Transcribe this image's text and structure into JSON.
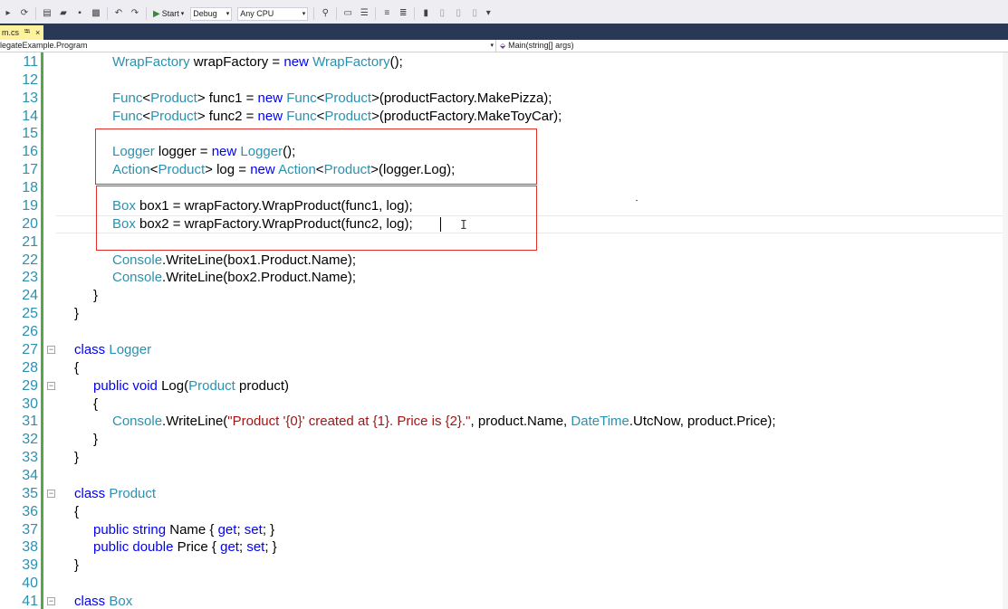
{
  "toolbar": {
    "start_label": "Start",
    "config": "Debug",
    "platform": "Any CPU"
  },
  "tab": {
    "label": "m.cs",
    "pin": "⭾",
    "close": "×"
  },
  "navbar": {
    "left": "legateExample.Program",
    "right": "Main(string[] args)"
  },
  "colors": {
    "keyword": "#0000ff",
    "type": "#2b91af",
    "string": "#a31515",
    "line_number": "#2b91af",
    "highlight_box": "#e0302c",
    "change_bar": "#57a64a"
  },
  "lines": [
    {
      "n": "11",
      "indent": 2,
      "tokens": [
        [
          "ty",
          "WrapFactory"
        ],
        [
          "p",
          " wrapFactory = "
        ],
        [
          "kw",
          "new"
        ],
        [
          "p",
          " "
        ],
        [
          "ty",
          "WrapFactory"
        ],
        [
          "p",
          "();"
        ]
      ]
    },
    {
      "n": "12",
      "indent": 0,
      "tokens": []
    },
    {
      "n": "13",
      "indent": 2,
      "tokens": [
        [
          "ty",
          "Func"
        ],
        [
          "p",
          "<"
        ],
        [
          "ty",
          "Product"
        ],
        [
          "p",
          "> func1 = "
        ],
        [
          "kw",
          "new"
        ],
        [
          "p",
          " "
        ],
        [
          "ty",
          "Func"
        ],
        [
          "p",
          "<"
        ],
        [
          "ty",
          "Product"
        ],
        [
          "p",
          ">(productFactory.MakePizza);"
        ]
      ]
    },
    {
      "n": "14",
      "indent": 2,
      "tokens": [
        [
          "ty",
          "Func"
        ],
        [
          "p",
          "<"
        ],
        [
          "ty",
          "Product"
        ],
        [
          "p",
          "> func2 = "
        ],
        [
          "kw",
          "new"
        ],
        [
          "p",
          " "
        ],
        [
          "ty",
          "Func"
        ],
        [
          "p",
          "<"
        ],
        [
          "ty",
          "Product"
        ],
        [
          "p",
          ">(productFactory.MakeToyCar);"
        ]
      ]
    },
    {
      "n": "15",
      "indent": 0,
      "tokens": []
    },
    {
      "n": "16",
      "indent": 2,
      "tokens": [
        [
          "ty",
          "Logger"
        ],
        [
          "p",
          " logger = "
        ],
        [
          "kw",
          "new"
        ],
        [
          "p",
          " "
        ],
        [
          "ty",
          "Logger"
        ],
        [
          "p",
          "();"
        ]
      ]
    },
    {
      "n": "17",
      "indent": 2,
      "tokens": [
        [
          "ty",
          "Action"
        ],
        [
          "p",
          "<"
        ],
        [
          "ty",
          "Product"
        ],
        [
          "p",
          "> log = "
        ],
        [
          "kw",
          "new"
        ],
        [
          "p",
          " "
        ],
        [
          "ty",
          "Action"
        ],
        [
          "p",
          "<"
        ],
        [
          "ty",
          "Product"
        ],
        [
          "p",
          ">(logger.Log);"
        ]
      ]
    },
    {
      "n": "18",
      "indent": 0,
      "tokens": []
    },
    {
      "n": "19",
      "indent": 2,
      "tokens": [
        [
          "ty",
          "Box"
        ],
        [
          "p",
          " box1 = wrapFactory.WrapProduct(func1, log);"
        ]
      ]
    },
    {
      "n": "20",
      "indent": 2,
      "tokens": [
        [
          "ty",
          "Box"
        ],
        [
          "p",
          " box2 = wrapFactory.WrapProduct(func2, log);"
        ]
      ]
    },
    {
      "n": "21",
      "indent": 0,
      "tokens": []
    },
    {
      "n": "22",
      "indent": 2,
      "tokens": [
        [
          "ty",
          "Console"
        ],
        [
          "p",
          ".WriteLine(box1.Product.Name);"
        ]
      ]
    },
    {
      "n": "23",
      "indent": 2,
      "tokens": [
        [
          "ty",
          "Console"
        ],
        [
          "p",
          ".WriteLine(box2.Product.Name);"
        ]
      ]
    },
    {
      "n": "24",
      "indent": 1,
      "tokens": [
        [
          "p",
          "}"
        ]
      ]
    },
    {
      "n": "25",
      "indent": 0,
      "tokens": [
        [
          "p",
          "}"
        ]
      ]
    },
    {
      "n": "26",
      "indent": 0,
      "tokens": []
    },
    {
      "n": "27",
      "indent": 0,
      "fold": true,
      "tokens": [
        [
          "kw",
          "class"
        ],
        [
          "p",
          " "
        ],
        [
          "ty",
          "Logger"
        ]
      ]
    },
    {
      "n": "28",
      "indent": 0,
      "tokens": [
        [
          "p",
          "{"
        ]
      ]
    },
    {
      "n": "29",
      "indent": 1,
      "fold": true,
      "tokens": [
        [
          "kw",
          "public"
        ],
        [
          "p",
          " "
        ],
        [
          "kw",
          "void"
        ],
        [
          "p",
          " Log("
        ],
        [
          "ty",
          "Product"
        ],
        [
          "p",
          " product)"
        ]
      ]
    },
    {
      "n": "30",
      "indent": 1,
      "tokens": [
        [
          "p",
          "{"
        ]
      ]
    },
    {
      "n": "31",
      "indent": 2,
      "tokens": [
        [
          "ty",
          "Console"
        ],
        [
          "p",
          ".WriteLine("
        ],
        [
          "str",
          "\"Product '{0}' created at {1}. Price is {2}.\""
        ],
        [
          "p",
          ", product.Name, "
        ],
        [
          "ty",
          "DateTime"
        ],
        [
          "p",
          ".UtcNow, product.Price);"
        ]
      ]
    },
    {
      "n": "32",
      "indent": 1,
      "tokens": [
        [
          "p",
          "}"
        ]
      ]
    },
    {
      "n": "33",
      "indent": 0,
      "tokens": [
        [
          "p",
          "}"
        ]
      ]
    },
    {
      "n": "34",
      "indent": 0,
      "tokens": []
    },
    {
      "n": "35",
      "indent": 0,
      "fold": true,
      "tokens": [
        [
          "kw",
          "class"
        ],
        [
          "p",
          " "
        ],
        [
          "ty",
          "Product"
        ]
      ]
    },
    {
      "n": "36",
      "indent": 0,
      "tokens": [
        [
          "p",
          "{"
        ]
      ]
    },
    {
      "n": "37",
      "indent": 1,
      "tokens": [
        [
          "kw",
          "public"
        ],
        [
          "p",
          " "
        ],
        [
          "kw",
          "string"
        ],
        [
          "p",
          " Name { "
        ],
        [
          "kw",
          "get"
        ],
        [
          "p",
          "; "
        ],
        [
          "kw",
          "set"
        ],
        [
          "p",
          "; }"
        ]
      ]
    },
    {
      "n": "38",
      "indent": 1,
      "tokens": [
        [
          "kw",
          "public"
        ],
        [
          "p",
          " "
        ],
        [
          "kw",
          "double"
        ],
        [
          "p",
          " Price { "
        ],
        [
          "kw",
          "get"
        ],
        [
          "p",
          "; "
        ],
        [
          "kw",
          "set"
        ],
        [
          "p",
          "; }"
        ]
      ]
    },
    {
      "n": "39",
      "indent": 0,
      "tokens": [
        [
          "p",
          "}"
        ]
      ]
    },
    {
      "n": "40",
      "indent": 0,
      "tokens": []
    },
    {
      "n": "41",
      "indent": 0,
      "fold": true,
      "tokens": [
        [
          "kw",
          "class"
        ],
        [
          "p",
          " "
        ],
        [
          "ty",
          "Box"
        ]
      ]
    }
  ]
}
